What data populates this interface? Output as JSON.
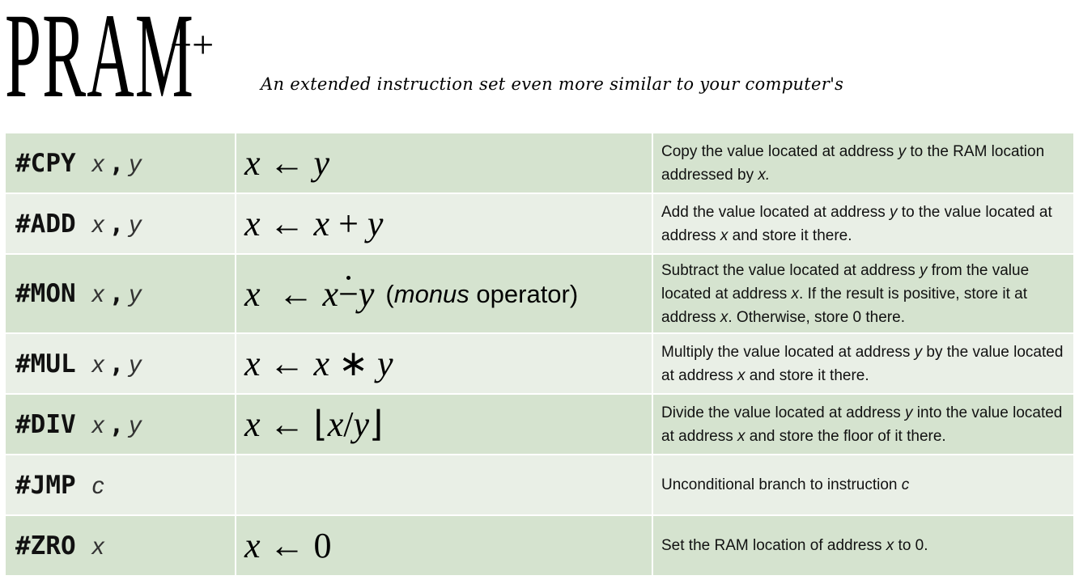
{
  "header": {
    "title": "PRAM",
    "title_superscript": "++",
    "subtitle": "An extended instruction set even more similar to your computer's"
  },
  "instructions": [
    {
      "opcode": "#CPY",
      "args": [
        "x",
        "y"
      ],
      "semantics": {
        "lhs": "x",
        "arrow": "←",
        "rhs": "y"
      },
      "description": [
        {
          "t": "Copy the value located at address "
        },
        {
          "t": "y",
          "i": true
        },
        {
          "t": " to the RAM location addressed by "
        },
        {
          "t": "x.",
          "i": true
        }
      ]
    },
    {
      "opcode": "#ADD",
      "args": [
        "x",
        "y"
      ],
      "semantics": {
        "lhs": "x",
        "arrow": "←",
        "rhs_a": "x",
        "op": "+",
        "rhs_b": "y"
      },
      "description": [
        {
          "t": "Add the value located at address "
        },
        {
          "t": "y",
          "i": true
        },
        {
          "t": " to the value located at address "
        },
        {
          "t": "x",
          "i": true
        },
        {
          "t": " and store it there."
        }
      ]
    },
    {
      "opcode": "#MON",
      "args": [
        "x",
        "y"
      ],
      "semantics": {
        "lhs": "x",
        "arrow": "←",
        "rhs_a": "x",
        "op": "−",
        "rhs_b": "y",
        "note_open": "(",
        "note_italic": "monus",
        "note_rest": " operator)"
      },
      "description": [
        {
          "t": "Subtract the value located at address "
        },
        {
          "t": "y",
          "i": true
        },
        {
          "t": " from the value located at address "
        },
        {
          "t": "x",
          "i": true
        },
        {
          "t": ". If the result is positive, store it at address "
        },
        {
          "t": "x",
          "i": true
        },
        {
          "t": ". Otherwise, store 0 there."
        }
      ]
    },
    {
      "opcode": "#MUL",
      "args": [
        "x",
        "y"
      ],
      "semantics": {
        "lhs": "x",
        "arrow": "←",
        "rhs_a": "x",
        "op": "∗",
        "rhs_b": "y"
      },
      "description": [
        {
          "t": "Multiply the value located at address "
        },
        {
          "t": "y",
          "i": true
        },
        {
          "t": " by the value located at address "
        },
        {
          "t": "x",
          "i": true
        },
        {
          "t": " and store it there."
        }
      ]
    },
    {
      "opcode": "#DIV",
      "args": [
        "x",
        "y"
      ],
      "semantics": {
        "lhs": "x",
        "arrow": "←",
        "lfloor": "⌊",
        "rhs_a": "x",
        "op": "/",
        "rhs_b": "y",
        "rfloor": "⌋"
      },
      "description": [
        {
          "t": "Divide the value located at address "
        },
        {
          "t": "y",
          "i": true
        },
        {
          "t": " into the value located at address "
        },
        {
          "t": "x",
          "i": true
        },
        {
          "t": " and store the floor of it there."
        }
      ]
    },
    {
      "opcode": "#JMP",
      "args": [
        "c"
      ],
      "semantics": {},
      "description": [
        {
          "t": "Unconditional branch to instruction "
        },
        {
          "t": "c",
          "i": true
        }
      ]
    },
    {
      "opcode": "#ZRO",
      "args": [
        "x"
      ],
      "semantics": {
        "lhs": "x",
        "arrow": "←",
        "rhs": "0"
      },
      "description": [
        {
          "t": "Set the RAM location of address "
        },
        {
          "t": "x",
          "i": true
        },
        {
          "t": " to 0."
        }
      ]
    }
  ]
}
